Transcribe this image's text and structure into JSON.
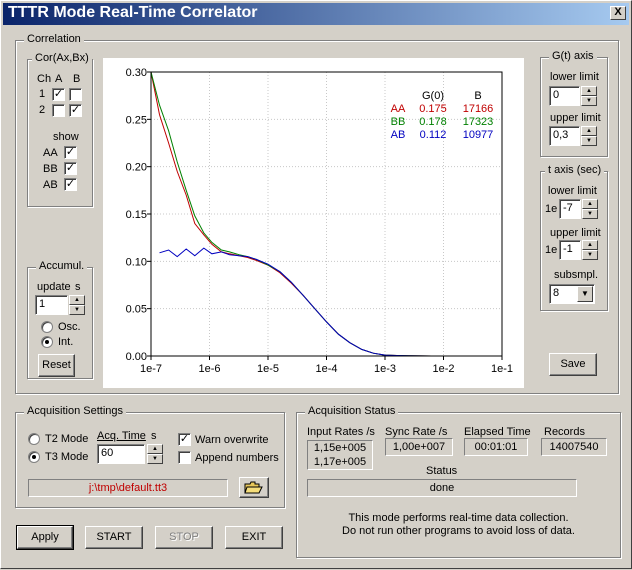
{
  "window": {
    "title": "TTTR Mode Real-Time Correlator",
    "close_glyph": "X"
  },
  "correlation": {
    "group_label": "Correlation",
    "cor_label": "Cor(Ax,Bx)",
    "ch_header": "Ch",
    "a_header": "A",
    "b_header": "B",
    "rows": [
      {
        "ch": "1",
        "a_checked": true,
        "b_checked": false
      },
      {
        "ch": "2",
        "a_checked": false,
        "b_checked": true
      }
    ],
    "show_label": "show",
    "show_items": [
      {
        "label": "AA",
        "checked": true
      },
      {
        "label": "BB",
        "checked": true
      },
      {
        "label": "AB",
        "checked": true
      }
    ]
  },
  "accumul": {
    "group_label": "Accumul.",
    "update_label": "update",
    "update_unit": "s",
    "update_value": "1",
    "osc_label": "Osc.",
    "int_label": "Int.",
    "selected": "Int.",
    "reset_label": "Reset"
  },
  "gt_axis": {
    "group_label": "G(t) axis",
    "lower_label": "lower limit",
    "lower_value": "0",
    "upper_label": "upper limit",
    "upper_value": "0,3"
  },
  "t_axis": {
    "group_label": "t axis (sec)",
    "lower_label": "lower limit",
    "lower_prefix": "1e",
    "lower_value": "-7",
    "upper_label": "upper limit",
    "upper_prefix": "1e",
    "upper_value": "-1",
    "subsmpl_label": "subsmpl.",
    "subsmpl_value": "8"
  },
  "save_label": "Save",
  "chart_data": {
    "type": "line",
    "xscale": "log",
    "xlim": [
      1e-07,
      0.1
    ],
    "ylim": [
      0,
      0.3
    ],
    "x_tick_labels": [
      "1e-7",
      "1e-6",
      "1e-5",
      "1e-4",
      "1e-3",
      "1e-2",
      "1e-1"
    ],
    "y_tick_labels": [
      "0.00",
      "0.05",
      "0.10",
      "0.15",
      "0.20",
      "0.25",
      "0.30"
    ],
    "grid": true,
    "legend_headers": [
      "G(0)",
      "B"
    ],
    "series": [
      {
        "name": "AA",
        "color": "#c00000",
        "g0": "0.175",
        "b": "17166",
        "x": [
          1e-07,
          1.4e-07,
          2e-07,
          2.8e-07,
          4e-07,
          5.6e-07,
          8e-07,
          1.1e-06,
          1.6e-06,
          2.2e-06,
          3.2e-06,
          4.5e-06,
          6.3e-06,
          1e-05,
          1.6e-05,
          2.5e-05,
          4e-05,
          6.3e-05,
          0.0001,
          0.00016,
          0.00025,
          0.0004,
          0.00063,
          0.001,
          0.0016,
          0.0025,
          0.004,
          0.0063,
          0.01
        ],
        "y": [
          0.3,
          0.255,
          0.225,
          0.195,
          0.17,
          0.14,
          0.128,
          0.118,
          0.11,
          0.108,
          0.106,
          0.104,
          0.101,
          0.096,
          0.088,
          0.077,
          0.064,
          0.05,
          0.036,
          0.023,
          0.014,
          0.007,
          0.003,
          0.001,
          0.0005,
          0.0002,
          0.0001,
          0.0,
          0.0
        ]
      },
      {
        "name": "BB",
        "color": "#008000",
        "g0": "0.178",
        "b": "17323",
        "x": [
          1e-07,
          1.4e-07,
          2e-07,
          2.8e-07,
          4e-07,
          5.6e-07,
          8e-07,
          1.1e-06,
          1.6e-06,
          2.2e-06,
          3.2e-06,
          4.5e-06,
          6.3e-06,
          1e-05,
          1.6e-05,
          2.5e-05,
          4e-05,
          6.3e-05,
          0.0001,
          0.00016,
          0.00025,
          0.0004,
          0.00063,
          0.001,
          0.0016,
          0.0025,
          0.004,
          0.0063,
          0.01
        ],
        "y": [
          0.3,
          0.265,
          0.238,
          0.205,
          0.175,
          0.148,
          0.13,
          0.12,
          0.112,
          0.11,
          0.107,
          0.105,
          0.102,
          0.096,
          0.089,
          0.078,
          0.064,
          0.05,
          0.036,
          0.023,
          0.014,
          0.007,
          0.003,
          0.001,
          0.0005,
          0.0002,
          0.0001,
          0.0,
          0.0
        ]
      },
      {
        "name": "AB",
        "color": "#0000c0",
        "g0": "0.112",
        "b": "10977",
        "x": [
          1.4e-07,
          2e-07,
          2.8e-07,
          4e-07,
          5.6e-07,
          8e-07,
          1.1e-06,
          1.6e-06,
          2.2e-06,
          3.2e-06,
          4.5e-06,
          6.3e-06,
          1e-05,
          1.6e-05,
          2.5e-05,
          4e-05,
          6.3e-05,
          0.0001,
          0.00016,
          0.00025,
          0.0004,
          0.00063,
          0.001,
          0.0016,
          0.0025,
          0.004,
          0.0063,
          0.01
        ],
        "y": [
          0.109,
          0.112,
          0.105,
          0.113,
          0.106,
          0.114,
          0.108,
          0.11,
          0.107,
          0.106,
          0.105,
          0.102,
          0.097,
          0.089,
          0.078,
          0.064,
          0.05,
          0.036,
          0.023,
          0.014,
          0.007,
          0.003,
          0.001,
          0.0005,
          0.0002,
          0.0001,
          0.0,
          0.0
        ]
      }
    ]
  },
  "acq_settings": {
    "group_label": "Acquisition Settings",
    "t2_label": "T2 Mode",
    "t3_label": "T3 Mode",
    "selected_mode": "T3 Mode",
    "acq_time_label": "Acq. Time",
    "acq_time_unit": "s",
    "acq_time_value": "60",
    "warn_label": "Warn overwrite",
    "warn_checked": true,
    "append_label": "Append numbers",
    "append_checked": false,
    "file_path": "j:\\tmp\\default.tt3"
  },
  "buttons": {
    "apply": "Apply",
    "start": "START",
    "stop": "STOP",
    "exit": "EXIT"
  },
  "acq_status": {
    "group_label": "Acquisition Status",
    "input_rates_label": "Input Rates /s",
    "input_rates": [
      "1,15e+005",
      "1,17e+005"
    ],
    "sync_rate_label": "Sync Rate /s",
    "sync_rate": "1,00e+007",
    "elapsed_label": "Elapsed Time",
    "elapsed": "00:01:01",
    "records_label": "Records",
    "records": "14007540",
    "status_label": "Status",
    "status": "done",
    "note_line1": "This mode performs real-time data collection.",
    "note_line2": "Do not run other programs to avoid loss of data."
  }
}
